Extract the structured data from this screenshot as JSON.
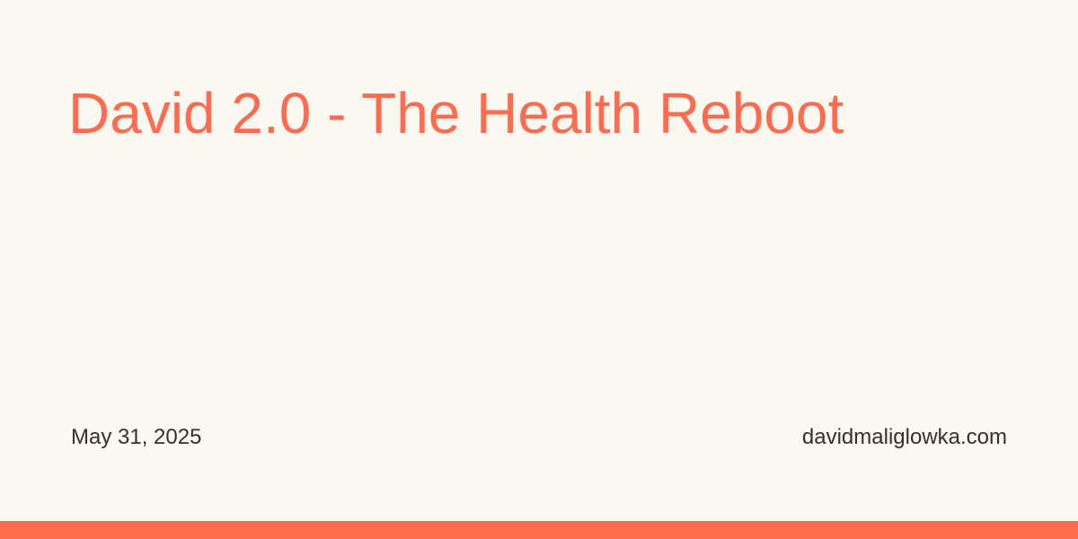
{
  "card": {
    "title": "David 2.0 - The Health Reboot",
    "date": "May 31, 2025",
    "site": "davidmaliglowka.com"
  },
  "colors": {
    "background": "#fbf7f1",
    "accent": "#ff6b4f",
    "text": "#3a2e2c"
  }
}
